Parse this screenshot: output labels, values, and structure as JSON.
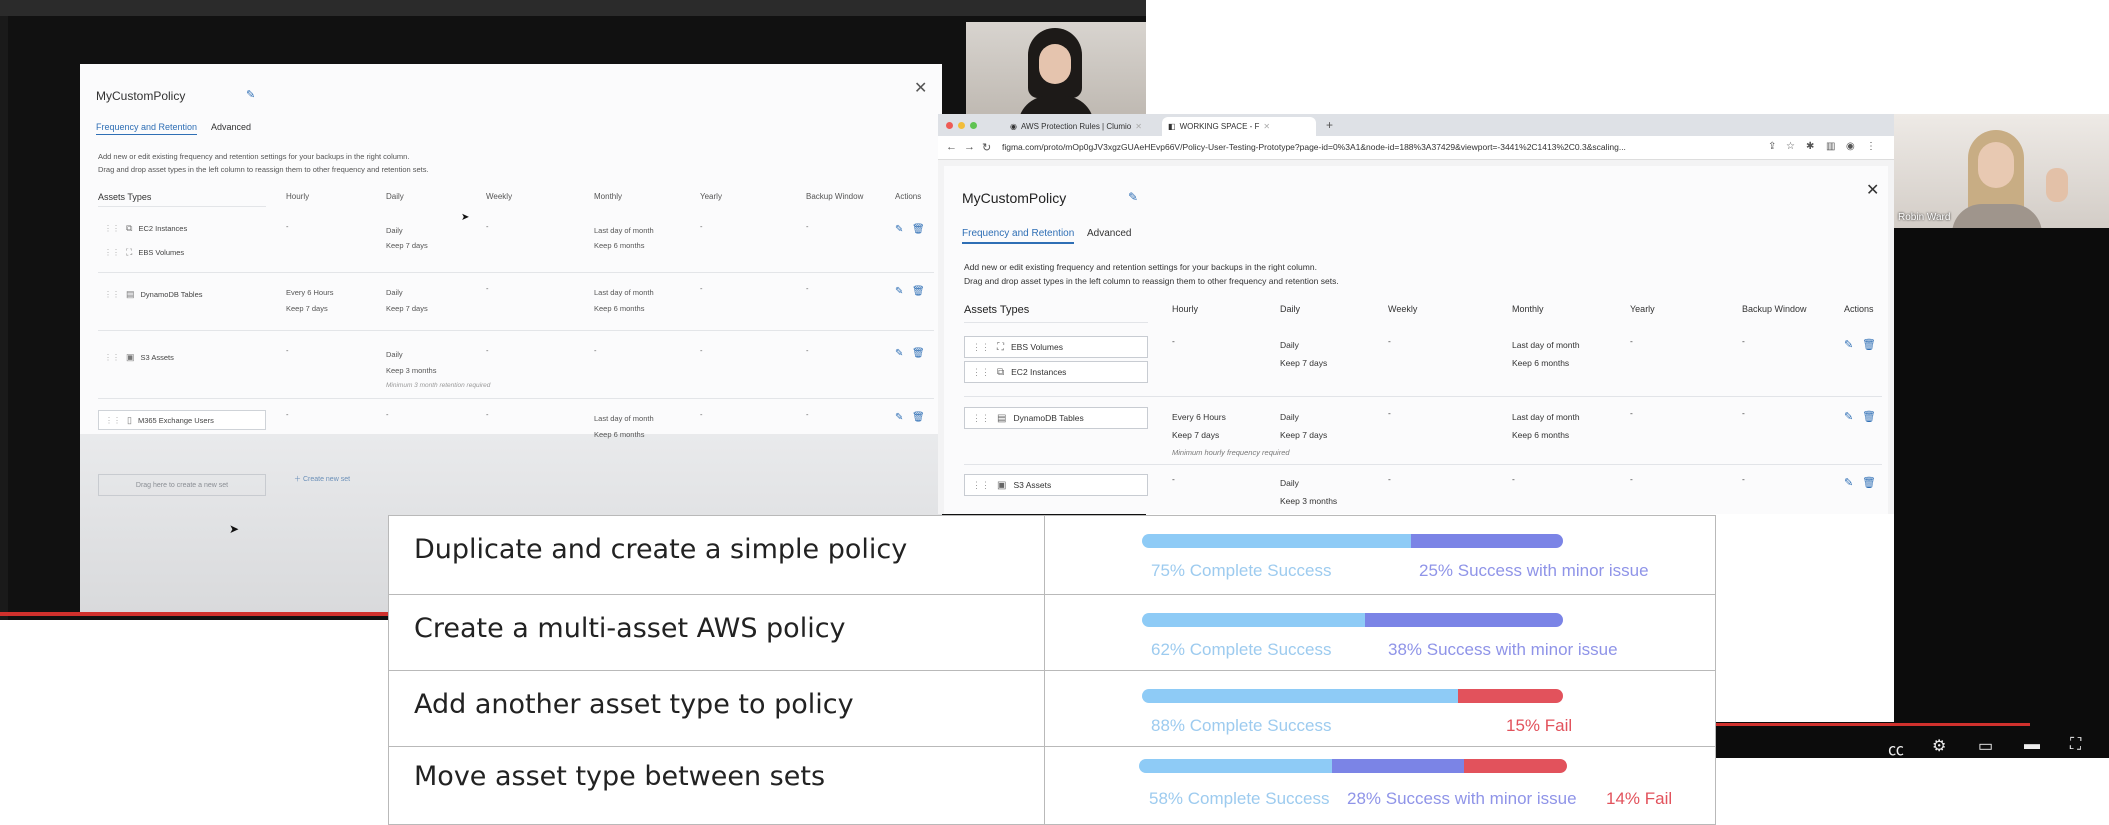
{
  "left_video": {
    "modal": {
      "title": "MyCustomPolicy",
      "tabs": [
        "Frequency and Retention",
        "Advanced"
      ],
      "description": [
        "Add new or edit existing frequency and retention settings for your backups in the right column.",
        "Drag and drop asset types in the left column to reassign them to other frequency and retention sets."
      ],
      "columns": [
        "Assets Types",
        "Hourly",
        "Daily",
        "Weekly",
        "Monthly",
        "Yearly",
        "Backup Window",
        "Actions"
      ],
      "rows": [
        {
          "assets": [
            "EC2 Instances",
            "EBS Volumes"
          ],
          "hourly": "-",
          "daily": [
            "Daily",
            "Keep 7 days"
          ],
          "daily_note": "",
          "weekly": "-",
          "monthly": [
            "Last day of month",
            "Keep 6 months"
          ],
          "yearly": "-",
          "window": "-"
        },
        {
          "assets": [
            "DynamoDB Tables"
          ],
          "hourly": [
            "Every 6 Hours",
            "Keep 7 days"
          ],
          "daily": [
            "Daily",
            "Keep 7 days"
          ],
          "daily_note": "",
          "weekly": "-",
          "monthly": [
            "Last day of month",
            "Keep 6 months"
          ],
          "yearly": "-",
          "window": "-"
        },
        {
          "assets": [
            "S3 Assets"
          ],
          "hourly": "-",
          "daily": [
            "Daily",
            "Keep 3 months"
          ],
          "daily_note": "Minimum 3 month retention required",
          "weekly": "-",
          "monthly": "-",
          "yearly": "-",
          "window": "-"
        },
        {
          "assets": [
            "M365 Exchange Users"
          ],
          "hourly": "-",
          "daily": "-",
          "daily_note": "",
          "weekly": "-",
          "monthly": [
            "Last day of month",
            "Keep 6 months"
          ],
          "yearly": "-",
          "window": "-"
        }
      ],
      "dropzone": "Drag here to create a new set",
      "create_set": "Create new set"
    }
  },
  "right_video": {
    "browser": {
      "tabs": [
        "AWS Protection Rules | Clumio",
        "WORKING SPACE - F"
      ],
      "url": "figma.com/proto/mOp0gJV3xgzGUAeHEvp66V/Policy-User-Testing-Prototype?page-id=0%3A1&node-id=188%3A37429&viewport=-3441%2C1413%2C0.3&scaling..."
    },
    "modal": {
      "title": "MyCustomPolicy",
      "tabs": [
        "Frequency and Retention",
        "Advanced"
      ],
      "description": [
        "Add new or edit existing frequency and retention settings for your backups in the right column.",
        "Drag and drop asset types in the left column to reassign them to other frequency and retention sets."
      ],
      "columns": [
        "Assets Types",
        "Hourly",
        "Daily",
        "Weekly",
        "Monthly",
        "Yearly",
        "Backup Window",
        "Actions"
      ],
      "rows": [
        {
          "assets": [
            "EBS Volumes",
            "EC2 Instances"
          ],
          "hourly": "-",
          "daily": [
            "Daily",
            "Keep 7 days"
          ],
          "weekly": "-",
          "monthly": [
            "Last day of month",
            "Keep 6 months"
          ],
          "yearly": "-",
          "window": "-"
        },
        {
          "assets": [
            "DynamoDB Tables"
          ],
          "hourly": [
            "Every 6 Hours",
            "Keep 7 days"
          ],
          "hourly_note": "Minimum hourly frequency required",
          "daily": [
            "Daily",
            "Keep 7 days"
          ],
          "weekly": "-",
          "monthly": [
            "Last day of month",
            "Keep 6 months"
          ],
          "yearly": "-",
          "window": "-"
        },
        {
          "assets": [
            "S3 Assets"
          ],
          "hourly": "-",
          "daily": [
            "Daily",
            "Keep 3 months"
          ],
          "weekly": "-",
          "monthly": "-",
          "yearly": "-",
          "window": "-"
        }
      ]
    },
    "participant_name": "Robin Ward"
  },
  "results": {
    "colors": {
      "complete": "#8ecbf6",
      "minor": "#7b84e6",
      "fail": "#e2525c",
      "complete_text": "#9dcbef",
      "minor_text": "#8f94e8",
      "fail_text": "#e2525c"
    },
    "tasks": [
      {
        "name": "Duplicate and create a simple policy",
        "complete": 64,
        "minor": 36,
        "fail": 0,
        "labels": [
          "75% Complete Success",
          "25% Success with minor issue"
        ],
        "label_kinds": [
          "complete",
          "minor"
        ]
      },
      {
        "name": "Create a multi-asset AWS policy",
        "complete": 53,
        "minor": 47,
        "fail": 0,
        "labels": [
          "62% Complete Success",
          "38% Success with minor issue"
        ],
        "label_kinds": [
          "complete",
          "minor"
        ]
      },
      {
        "name": "Add another asset type to policy",
        "complete": 75,
        "minor": 0,
        "fail": 25,
        "labels": [
          "88% Complete Success",
          "15% Fail"
        ],
        "label_kinds": [
          "complete",
          "fail"
        ]
      },
      {
        "name": "Move asset type between sets",
        "complete": 45,
        "minor": 31,
        "fail": 24,
        "labels": [
          "58% Complete Success",
          "28% Success with minor issue",
          "14% Fail"
        ],
        "label_kinds": [
          "complete",
          "minor",
          "fail"
        ]
      }
    ]
  }
}
